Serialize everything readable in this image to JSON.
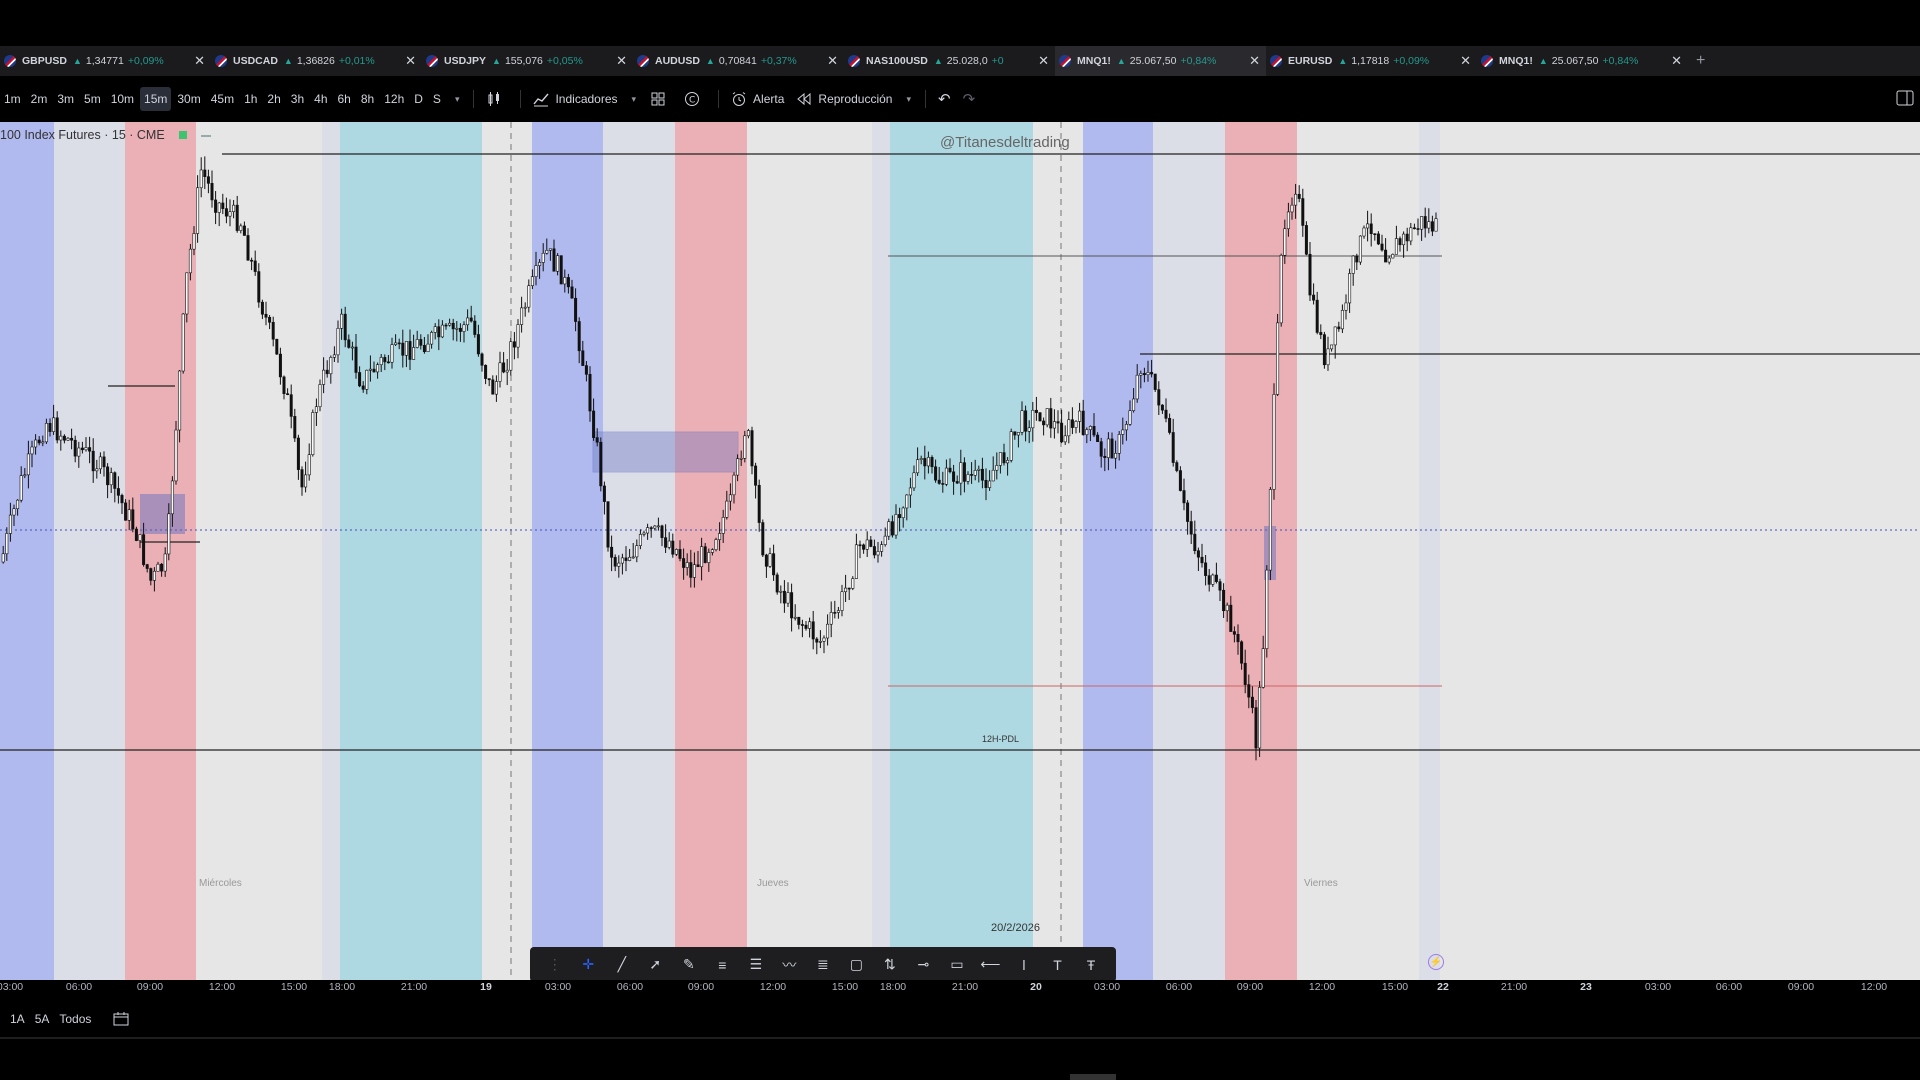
{
  "tabs": [
    {
      "symbol": "GBPUSD",
      "price": "1,34771",
      "change": "+0,09%"
    },
    {
      "symbol": "USDCAD",
      "price": "1,36826",
      "change": "+0,01%"
    },
    {
      "symbol": "USDJPY",
      "price": "155,076",
      "change": "+0,05%"
    },
    {
      "symbol": "AUDUSD",
      "price": "0,70841",
      "change": "+0,37%"
    },
    {
      "symbol": "NAS100USD",
      "price": "25.028,0",
      "change": "+0"
    },
    {
      "symbol": "MNQ1!",
      "price": "25.067,50",
      "change": "+0,84%"
    },
    {
      "symbol": "EURUSD",
      "price": "1,17818",
      "change": "+0,09%"
    },
    {
      "symbol": "MNQ1!",
      "price": "25.067,50",
      "change": "+0,84%"
    }
  ],
  "toolbar": {
    "timeframes": [
      "1m",
      "2m",
      "3m",
      "5m",
      "10m",
      "15m",
      "30m",
      "45m",
      "1h",
      "2h",
      "3h",
      "4h",
      "6h",
      "8h",
      "12h",
      "D",
      "S"
    ],
    "active_timeframe": "15m",
    "indicators_label": "Indicadores",
    "alert_label": "Alerta",
    "replay_label": "Reproducción"
  },
  "chart": {
    "legend": "100 Index Futures · 15 · CME",
    "watermark": "@Titanesdeltrading",
    "day_labels": [
      "Miércoles",
      "Jueves",
      "Viernes"
    ],
    "pdl_label": "12H-PDL",
    "date_badge": "20/2/2026",
    "session_colors": {
      "asia": "#a7b2ee",
      "london": "#eaa6ad",
      "ny": "#a4d6e1",
      "neutral": "#d8dbe6"
    }
  },
  "chart_data": {
    "type": "candlestick",
    "title": "100 Index Futures · 15 · CME",
    "x_tick_labels": [
      "03:00",
      "06:00",
      "09:00",
      "12:00",
      "15:00",
      "18:00",
      "21:00",
      "19",
      "03:00",
      "06:00",
      "09:00",
      "12:00",
      "15:00",
      "18:00",
      "21:00",
      "20",
      "03:00",
      "06:00",
      "09:00",
      "12:00",
      "15:00",
      "22",
      "21:00",
      "23",
      "03:00",
      "06:00",
      "09:00",
      "12:00"
    ],
    "last_price": "25.067,50",
    "grid": false
  },
  "time_axis": [
    "03:00",
    "06:00",
    "09:00",
    "12:00",
    "15:00",
    "18:00",
    "21:00",
    "19",
    "03:00",
    "06:00",
    "09:00",
    "12:00",
    "15:00",
    "18:00",
    "21:00",
    "20",
    "03:00",
    "06:00",
    "09:00",
    "12:00",
    "15:00",
    "22",
    "21:00",
    "23",
    "03:00",
    "06:00",
    "09:00",
    "12:00"
  ],
  "range_bar": {
    "r1": "1A",
    "r2": "5A",
    "r3": "Todos"
  }
}
